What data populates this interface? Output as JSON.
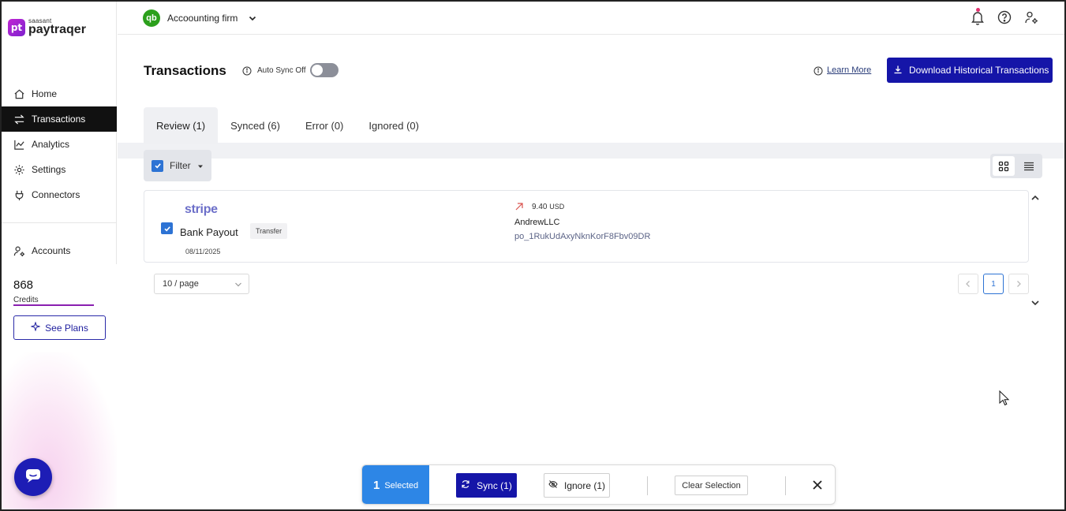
{
  "brand": {
    "logo_mark": "pt",
    "logo_small": "saasant",
    "logo_name": "paytraqer"
  },
  "sidebar": {
    "items": [
      {
        "label": "Home",
        "icon": "home-icon"
      },
      {
        "label": "Transactions",
        "icon": "transfer-icon",
        "active": true
      },
      {
        "label": "Analytics",
        "icon": "analytics-icon"
      },
      {
        "label": "Settings",
        "icon": "gear-icon"
      },
      {
        "label": "Connectors",
        "icon": "plug-icon"
      }
    ],
    "accounts_label": "Accounts",
    "credits_value": "868",
    "credits_label": "Credits",
    "see_plans_label": "See Plans"
  },
  "topbar": {
    "qb_mark": "qb",
    "firm_name": "Accoounting firm"
  },
  "header": {
    "title": "Transactions",
    "auto_sync_label": "Auto Sync Off",
    "auto_sync_on": false,
    "learn_more_label": "Learn More",
    "download_label": "Download Historical Transactions"
  },
  "tabs": [
    {
      "label": "Review (1)",
      "active": true
    },
    {
      "label": "Synced (6)"
    },
    {
      "label": "Error (0)"
    },
    {
      "label": "Ignored (0)"
    }
  ],
  "filter": {
    "label": "Filter"
  },
  "transaction": {
    "source": "stripe",
    "type": "Bank Payout",
    "tag": "Transfer",
    "date": "08/11/2025",
    "amount": "9.40",
    "currency": "USD",
    "payee": "AndrewLLC",
    "payout_id": "po_1RukUdAxyNknKorF8Fbv09DR"
  },
  "pagination": {
    "page_size": "10 / page",
    "current_page": "1"
  },
  "action_bar": {
    "selected_count": "1",
    "selected_label": "Selected",
    "sync_label": "Sync (1)",
    "ignore_label": "Ignore (1)",
    "clear_label": "Clear Selection"
  },
  "colors": {
    "primary": "#1515a8",
    "selected_blue": "#2d86e6",
    "qb_green": "#2ca01c"
  }
}
